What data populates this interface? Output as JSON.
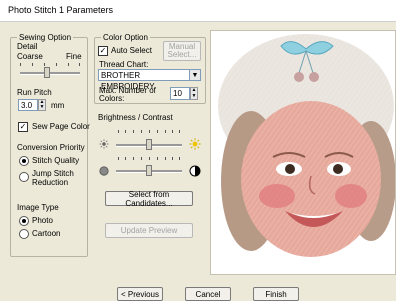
{
  "window": {
    "title": "Photo Stitch 1 Parameters"
  },
  "sewing_option": {
    "legend": "Sewing Option",
    "detail_label": "Detail",
    "coarse_label": "Coarse",
    "fine_label": "Fine",
    "detail_level": 0.45,
    "run_pitch_label": "Run Pitch",
    "run_pitch_value": "3.0",
    "run_pitch_unit": "mm",
    "sew_page_color_label": "Sew Page Color",
    "sew_page_color_checked": true,
    "conversion_priority_label": "Conversion Priority",
    "stitch_quality_label": "Stitch Quality",
    "jump_stitch_label_1": "Jump Stitch",
    "jump_stitch_label_2": "Reduction",
    "conversion_selected": "Stitch Quality",
    "image_type_label": "Image Type",
    "photo_label": "Photo",
    "cartoon_label": "Cartoon",
    "image_type_selected": "Photo"
  },
  "color_option": {
    "legend": "Color Option",
    "auto_select_label": "Auto Select",
    "auto_select_checked": true,
    "manual_select_label_1": "Manual",
    "manual_select_label_2": "Select...",
    "thread_chart_label": "Thread Chart:",
    "thread_chart_value": "BROTHER EMBROIDERY",
    "max_colors_label_1": "Max. Number of",
    "max_colors_label_2": "Colors:",
    "max_colors_value": "10"
  },
  "brightness_contrast": {
    "label": "Brightness / Contrast",
    "brightness_level": 0.5,
    "contrast_level": 0.5
  },
  "buttons": {
    "select_candidates": "Select from Candidates...",
    "update_preview": "Update Preview",
    "previous": "< Previous",
    "cancel": "Cancel",
    "finish": "Finish"
  },
  "icons": {
    "brightness_low": "sun-small-icon",
    "brightness_high": "sun-large-icon",
    "contrast_low": "contrast-low-icon",
    "contrast_high": "contrast-high-icon",
    "combo_arrow": "chevron-down-icon"
  }
}
